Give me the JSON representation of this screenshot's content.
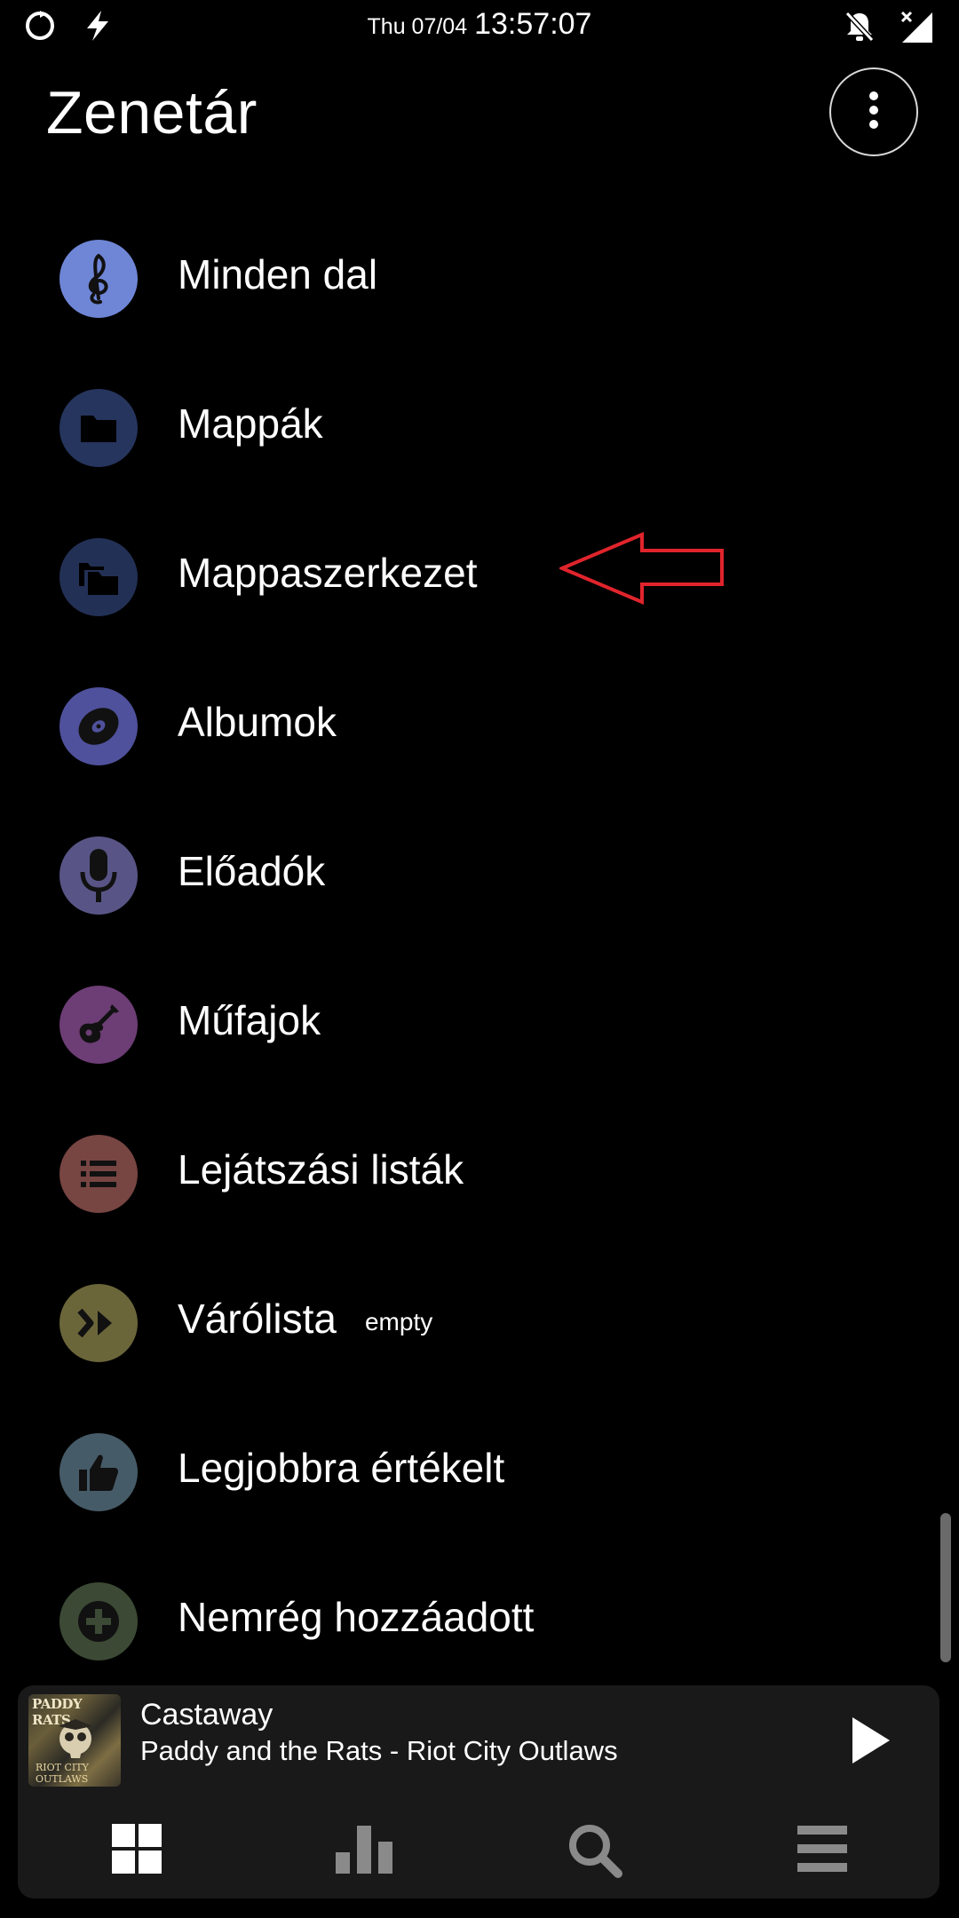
{
  "status_bar": {
    "date": "Thu 07/04",
    "time": "13:57:07",
    "left_icons": [
      "sync-icon",
      "flash-icon"
    ],
    "right_icons": [
      "notifications-off-icon",
      "no-signal-icon"
    ]
  },
  "header": {
    "title": "Zenetár",
    "menu_icon": "more-vert-icon"
  },
  "library_items": [
    {
      "label": "Minden dal",
      "icon": "treble-clef-icon",
      "color": "#6f86d6"
    },
    {
      "label": "Mappák",
      "icon": "folder-icon",
      "color": "#26355e"
    },
    {
      "label": "Mappaszerkezet",
      "icon": "folder-tree-icon",
      "color": "#233055"
    },
    {
      "label": "Albumok",
      "icon": "album-icon",
      "color": "#4f519c"
    },
    {
      "label": "Előadók",
      "icon": "microphone-icon",
      "color": "#585586"
    },
    {
      "label": "Műfajok",
      "icon": "guitar-icon",
      "color": "#6d3d75"
    },
    {
      "label": "Lejátszási listák",
      "icon": "playlist-icon",
      "color": "#774542"
    },
    {
      "label": "Várólista",
      "icon": "queue-icon",
      "color": "#6b663a",
      "badge": "empty"
    },
    {
      "label": "Legjobbra értékelt",
      "icon": "thumb-up-icon",
      "color": "#465b68"
    },
    {
      "label": "Nemrég hozzáadott",
      "icon": "add-icon",
      "color": "#3c4a35"
    }
  ],
  "now_playing": {
    "title": "Castaway",
    "subtitle": "Paddy and the Rats - Riot City Outlaws",
    "cover_text": "PADDY RATS",
    "cover_subtext": "RIOT CITY OUTLAWS",
    "play_icon": "play-icon"
  },
  "bottom_nav": [
    {
      "name": "library",
      "icon": "grid-icon",
      "active": true
    },
    {
      "name": "charts",
      "icon": "bar-chart-icon",
      "active": false
    },
    {
      "name": "search",
      "icon": "search-icon",
      "active": false
    },
    {
      "name": "queue",
      "icon": "menu-icon",
      "active": false
    }
  ],
  "colors": {
    "background": "#000000",
    "player_bg": "#191919",
    "annotation_arrow": "#e0242c",
    "nav_inactive": "#8a8a8a"
  }
}
